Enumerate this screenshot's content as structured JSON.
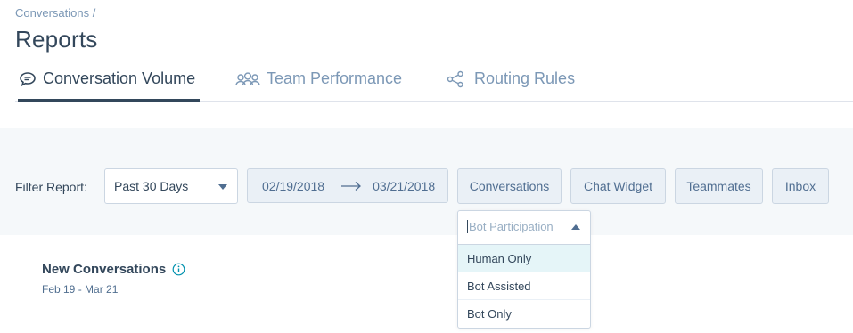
{
  "breadcrumb": "Conversations /",
  "title": "Reports",
  "tabs": [
    {
      "label": "Conversation Volume",
      "icon": "chat-bubble-icon",
      "active": true
    },
    {
      "label": "Team Performance",
      "icon": "team-icon",
      "active": false
    },
    {
      "label": "Routing Rules",
      "icon": "share-nodes-icon",
      "active": false
    }
  ],
  "filter": {
    "label": "Filter Report:",
    "range_select": "Past 30 Days",
    "start_date": "02/19/2018",
    "end_date": "03/21/2018",
    "buttons": [
      "Conversations",
      "Chat Widget",
      "Teammates",
      "Inbox"
    ]
  },
  "dropdown": {
    "placeholder": "Bot Participation",
    "options": [
      "Human Only",
      "Bot Assisted",
      "Bot Only"
    ],
    "highlighted": "Human Only"
  },
  "card": {
    "title": "New Conversations",
    "subtitle": "Feb 19 - Mar 21"
  },
  "colors": {
    "text": "#33475b",
    "muted": "#7c98b6",
    "filter_bg": "#f5f8fa",
    "button_bg": "#eaf0f6",
    "border": "#cbd6e2",
    "highlight": "#e5f5f8",
    "info_icon": "#0091ae"
  }
}
